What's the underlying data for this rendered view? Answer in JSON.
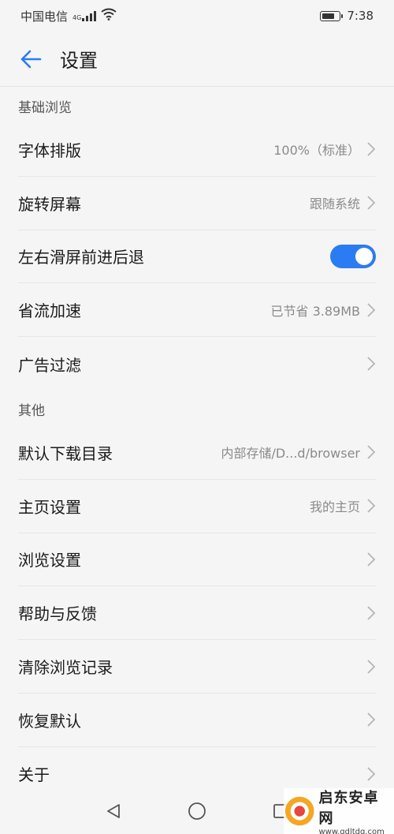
{
  "status_bar": {
    "carrier": "中国电信",
    "network": "4G",
    "time": "7:38"
  },
  "header": {
    "title": "设置"
  },
  "sections": [
    {
      "title": "基础浏览",
      "items": [
        {
          "label": "字体排版",
          "value": "100%（标准）",
          "type": "chevron"
        },
        {
          "label": "旋转屏幕",
          "value": "跟随系统",
          "type": "chevron"
        },
        {
          "label": "左右滑屏前进后退",
          "value": null,
          "type": "toggle",
          "toggle_on": true
        },
        {
          "label": "省流加速",
          "value": "已节省 3.89MB",
          "type": "chevron"
        },
        {
          "label": "广告过滤",
          "value": "",
          "type": "chevron"
        }
      ]
    },
    {
      "title": "其他",
      "items": [
        {
          "label": "默认下载目录",
          "value": "内部存储/D...d/browser",
          "type": "chevron"
        },
        {
          "label": "主页设置",
          "value": "我的主页",
          "type": "chevron"
        },
        {
          "label": "浏览设置",
          "value": "",
          "type": "chevron"
        },
        {
          "label": "帮助与反馈",
          "value": "",
          "type": "chevron"
        },
        {
          "label": "清除浏览记录",
          "value": "",
          "type": "chevron"
        },
        {
          "label": "恢复默认",
          "value": "",
          "type": "chevron"
        },
        {
          "label": "关于",
          "value": "",
          "type": "chevron"
        }
      ]
    }
  ],
  "nav_bar": {
    "icons": [
      "back-triangle-icon",
      "home-circle-icon",
      "recents-square-icon"
    ]
  },
  "watermark": {
    "title": "启东安卓网",
    "url": "www.qdltdq.com"
  },
  "colors": {
    "accent": "#2b7cf2",
    "background": "#f5f5f5",
    "divider": "#e6e6e6",
    "secondary_text": "#8a8a8a"
  }
}
